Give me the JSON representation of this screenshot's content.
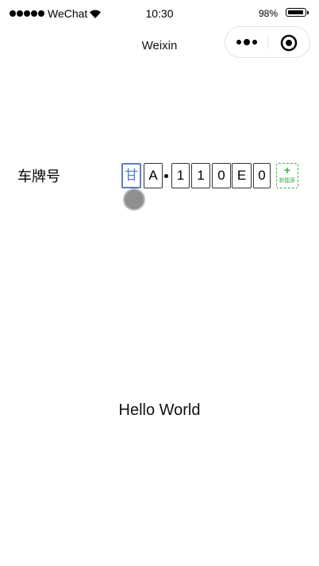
{
  "status_bar": {
    "carrier": "WeChat",
    "time": "10:30",
    "battery_percent": "98%",
    "battery_level": 0.98,
    "signal_bars": 5,
    "icons": [
      "signal-icon",
      "wifi-icon",
      "battery-icon"
    ]
  },
  "nav": {
    "title": "Weixin",
    "capsule": {
      "menu_icon": "more-dots-icon",
      "close_icon": "target-circle-icon"
    }
  },
  "plate": {
    "label": "车牌号",
    "chars": [
      "甘",
      "A",
      "1",
      "1",
      "0",
      "E",
      "0"
    ],
    "active_index": 0,
    "new_energy_plus": "+",
    "new_energy_label": "新能源"
  },
  "main": {
    "hello": "Hello World"
  },
  "colors": {
    "active_border": "#5b7fc7",
    "new_energy_green": "#3cb34a",
    "touch_indicator": "#8f8f8f"
  }
}
